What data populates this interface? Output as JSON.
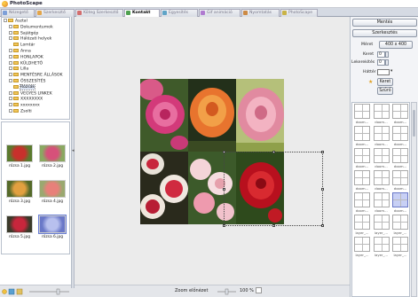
{
  "window": {
    "title": "PhotoScape"
  },
  "tabs": [
    {
      "label": "Nézegető",
      "icon": "viewer-icon",
      "color": "#7d9fd8"
    },
    {
      "label": "Szerkesztő",
      "icon": "editor-icon",
      "color": "#e3a54a"
    },
    {
      "label": "Köteg Szerkesztő",
      "icon": "batch-editor-icon",
      "color": "#d36e6e"
    },
    {
      "label": "Kontakt",
      "icon": "page-icon",
      "color": "#4fa04f",
      "active": true
    },
    {
      "label": "Egyesítés",
      "icon": "combine-icon",
      "color": "#5fa4c7"
    },
    {
      "label": "Gif animáció",
      "icon": "gif-icon",
      "color": "#b07ad0"
    },
    {
      "label": "Nyomtatás",
      "icon": "print-icon",
      "color": "#cc8a45"
    },
    {
      "label": "PhotoScape",
      "icon": "photoscape-icon",
      "color": "#c9b347"
    }
  ],
  "tree": [
    {
      "label": "Asztal",
      "depth": 0,
      "expander": true
    },
    {
      "label": "Dokumentumok",
      "depth": 1,
      "expander": true
    },
    {
      "label": "Sajátgép",
      "depth": 1,
      "expander": true
    },
    {
      "label": "Hálózati helyek",
      "depth": 1,
      "expander": true
    },
    {
      "label": "Lomtár",
      "depth": 1,
      "expander": false
    },
    {
      "label": "Anna",
      "depth": 1,
      "expander": true
    },
    {
      "label": "HONLAPOK",
      "depth": 1,
      "expander": true
    },
    {
      "label": "KÜLDHETŐ",
      "depth": 1,
      "expander": true
    },
    {
      "label": "Lilla",
      "depth": 1,
      "expander": true
    },
    {
      "label": "MENTÉSRE ÁLLÁSOK",
      "depth": 1,
      "expander": true
    },
    {
      "label": "ÖSSZESÍTÉS",
      "depth": 1,
      "expander": true
    },
    {
      "label": "Rózsák",
      "depth": 1,
      "expander": false,
      "selected": true
    },
    {
      "label": "VEGYES LINKEK",
      "depth": 1,
      "expander": true
    },
    {
      "label": "XXXXXXXX",
      "depth": 1,
      "expander": true
    },
    {
      "label": "xxxxxxxx",
      "depth": 1,
      "expander": true
    },
    {
      "label": "Zsolti",
      "depth": 1,
      "expander": true
    }
  ],
  "thumbnails": [
    {
      "caption": "rózsa 1.jpg",
      "colors": [
        "#5a7a2e",
        "#c8302c"
      ]
    },
    {
      "caption": "rózsa 2.jpg",
      "colors": [
        "#8aa862",
        "#d6517a"
      ]
    },
    {
      "caption": "rózsa 3.jpg",
      "colors": [
        "#556a2a",
        "#e2a040"
      ]
    },
    {
      "caption": "rózsa 4.jpg",
      "colors": [
        "#9aa870",
        "#e8807a"
      ]
    },
    {
      "caption": "rózsa 5.jpg",
      "colors": [
        "#3a3a2a",
        "#c8263c"
      ]
    },
    {
      "caption": "rózsa 6.jpg",
      "colors": [
        "#6a78c8",
        "#b8c0ee"
      ],
      "selected": true
    }
  ],
  "right": {
    "save_label": "Mentés",
    "edit_label": "Szerkesztés",
    "size_label": "Méret",
    "size_value": "400 x 400",
    "margin_label": "Keret",
    "margin_value": "0",
    "round_label": "Lekerekítés",
    "round_value": "0",
    "bg_label": "Háttér",
    "frame_button": "Keret",
    "filter_button": "Szűrő"
  },
  "layouts": [
    "doom...",
    "doom...",
    "doom...",
    "doom...",
    "doom...",
    "doom...",
    "doom...",
    "doom...",
    "doom...",
    "doom...",
    "doom...",
    "doom...",
    "doom...",
    "doom...",
    "doom...",
    "layer_...",
    "layer_...",
    "layer_...",
    "layer_...",
    "layer_...",
    "layer_..."
  ],
  "status": {
    "preview_label": "Zoom előnézet",
    "zoom_value": "100 %"
  }
}
